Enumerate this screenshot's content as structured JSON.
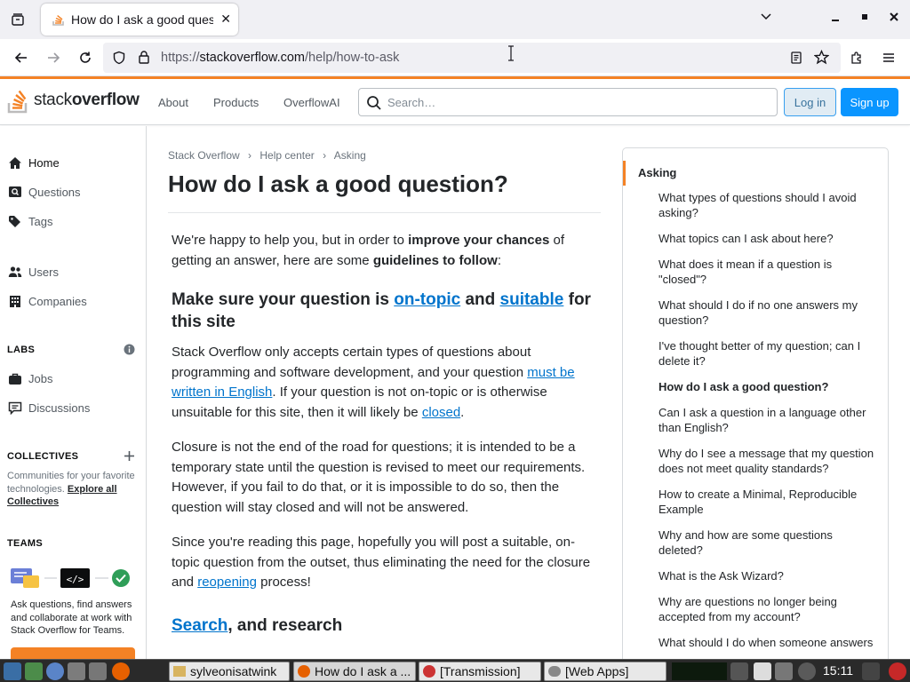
{
  "browser": {
    "tab_title": "How do I ask a good question?",
    "tab_close": "✕",
    "url_prefix": "https://",
    "url_domain": "stackoverflow.com",
    "url_path": "/help/how-to-ask"
  },
  "header": {
    "logo_light": "stack",
    "logo_bold": "overflow",
    "nav": [
      "About",
      "Products",
      "OverflowAI"
    ],
    "search_placeholder": "Search…",
    "login": "Log in",
    "signup": "Sign up"
  },
  "leftnav": {
    "home": "Home",
    "questions": "Questions",
    "tags": "Tags",
    "users": "Users",
    "companies": "Companies",
    "labs_heading": "LABS",
    "jobs": "Jobs",
    "discussions": "Discussions",
    "collectives_heading": "COLLECTIVES",
    "collectives_desc": "Communities for your favorite technologies.",
    "collectives_link": "Explore all Collectives",
    "teams_heading": "TEAMS",
    "teams_desc": "Ask questions, find answers and collaborate at work with Stack Overflow for Teams."
  },
  "breadcrumb": [
    "Stack Overflow",
    "Help center",
    "Asking"
  ],
  "page_title": "How do I ask a good question?",
  "article": {
    "intro_1": "We're happy to help you, but in order to ",
    "intro_b1": "improve your chances",
    "intro_2": " of getting an answer, here are some ",
    "intro_b2": "guidelines to follow",
    "intro_3": ":",
    "h1_a": "Make sure your question is ",
    "h1_link1": "on-topic",
    "h1_b": " and ",
    "h1_link2": "suitable",
    "h1_c": " for this site",
    "p1_a": "Stack Overflow only accepts certain types of questions about programming and software development, and your question ",
    "p1_link1": "must be written in English",
    "p1_b": ". If your question is not on-topic or is otherwise unsuitable for this site, then it will likely be ",
    "p1_link2": "closed",
    "p1_c": ".",
    "p2": "Closure is not the end of the road for questions; it is intended to be a temporary state until the question is revised to meet our requirements. However, if you fail to do that, or it is impossible to do so, then the question will stay closed and will not be answered.",
    "p3_a": "Since you're reading this page, hopefully you will post a suitable, on-topic question from the outset, thus eliminating the need for the closure and ",
    "p3_link": "reopening",
    "p3_b": " process!",
    "h2_link": "Search",
    "h2_rest": ", and research"
  },
  "sidebar": {
    "heading": "Asking",
    "items": [
      "What types of questions should I avoid asking?",
      "What topics can I ask about here?",
      "What does it mean if a question is \"closed\"?",
      "What should I do if no one answers my question?",
      "I've thought better of my question; can I delete it?",
      "How do I ask a good question?",
      "Can I ask a question in a language other than English?",
      "Why do I see a message that my question does not meet quality standards?",
      "How to create a Minimal, Reproducible Example",
      "Why and how are some questions deleted?",
      "What is the Ask Wizard?",
      "Why are questions no longer being accepted from my account?",
      "What should I do when someone answers"
    ],
    "active_index": 5
  },
  "taskbar": {
    "items": [
      "sylveonisatwink",
      "How do I ask a ...",
      "[Transmission]",
      "[Web Apps]"
    ],
    "clock": "15:11"
  },
  "colors": {
    "brand_orange": "#f48225",
    "link_blue": "#0074cc",
    "signup_blue": "#0a95ff"
  }
}
